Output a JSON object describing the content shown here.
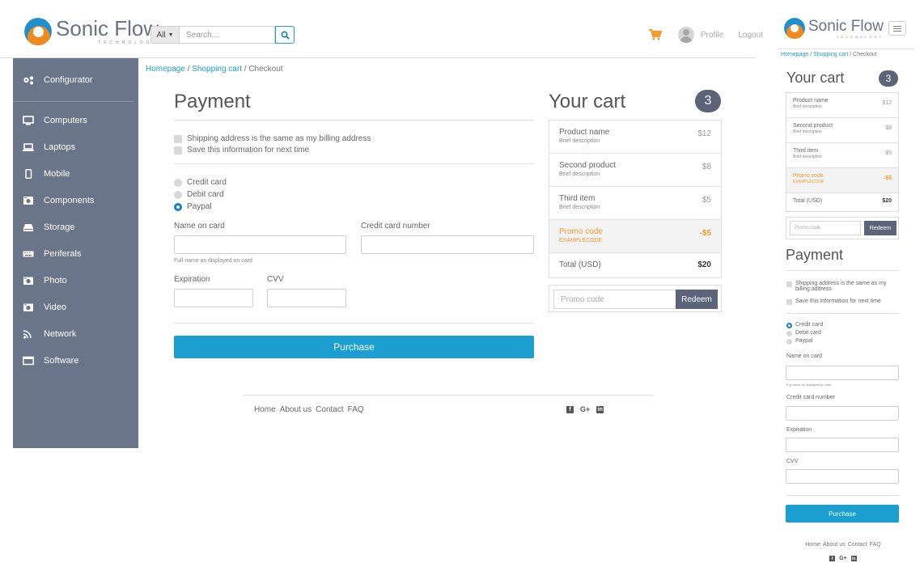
{
  "brand": {
    "name": "Sonic Flow",
    "tagline": "TECHNOLOGY"
  },
  "colors": {
    "accent": "#1a9fd0",
    "sidebar": "#6b7589",
    "promo": "#f39a2a",
    "badge": "#5b6478"
  },
  "header": {
    "scope_label": "All",
    "search_placeholder": "Search...",
    "profile_label": "Profile",
    "logout_label": "Logout",
    "icons": {
      "cart": "shopping-cart-icon",
      "search": "search-icon"
    }
  },
  "sidebar": {
    "items": [
      {
        "label": "Configurator",
        "icon": "gears-icon"
      },
      {
        "label": "Computers",
        "icon": "monitor-icon"
      },
      {
        "label": "Laptops",
        "icon": "laptop-icon"
      },
      {
        "label": "Mobile",
        "icon": "mobile-icon"
      },
      {
        "label": "Components",
        "icon": "components-icon"
      },
      {
        "label": "Storage",
        "icon": "hard-drive-icon"
      },
      {
        "label": "Periferals",
        "icon": "keyboard-icon"
      },
      {
        "label": "Photo",
        "icon": "camera-icon"
      },
      {
        "label": "Video",
        "icon": "video-camera-icon"
      },
      {
        "label": "Network",
        "icon": "wifi-icon"
      },
      {
        "label": "Software",
        "icon": "window-icon"
      }
    ]
  },
  "breadcrumb": {
    "home": "Homepage",
    "cart": "Shopping cart",
    "current": "Checkout",
    "sep": "/"
  },
  "payment": {
    "title": "Payment",
    "same_address": "Shipping address is the same as my billing address",
    "save_info": "Save this information for next time",
    "methods": [
      "Credit card",
      "Debit card",
      "Paypal"
    ],
    "desktop_selected": "Paypal",
    "mobile_selected": "Credit card",
    "name_label": "Name on card",
    "name_hint": "Full name as displayed on card",
    "number_label": "Credit card number",
    "expiration_label": "Expiration",
    "cvv_label": "CVV",
    "purchase_label": "Purchase"
  },
  "cart": {
    "title": "Your cart",
    "count": "3",
    "items": [
      {
        "name": "Product name",
        "desc": "Brief description",
        "price": "$12"
      },
      {
        "name": "Second product",
        "desc": "Brief description",
        "price": "$8"
      },
      {
        "name": "Third item",
        "desc": "Brief description",
        "price": "$5"
      }
    ],
    "promo": {
      "name": "Promo code",
      "code": "EXAMPLECODE",
      "amount": "-$5"
    },
    "total_label": "Total (USD)",
    "total_value": "$20",
    "promo_placeholder": "Promo code",
    "redeem_label": "Redeem"
  },
  "footer": {
    "links": [
      "Home",
      "About us",
      "Contact",
      "FAQ"
    ],
    "social": {
      "gplus": "G+",
      "facebook": "f",
      "linkedin": "in"
    }
  }
}
